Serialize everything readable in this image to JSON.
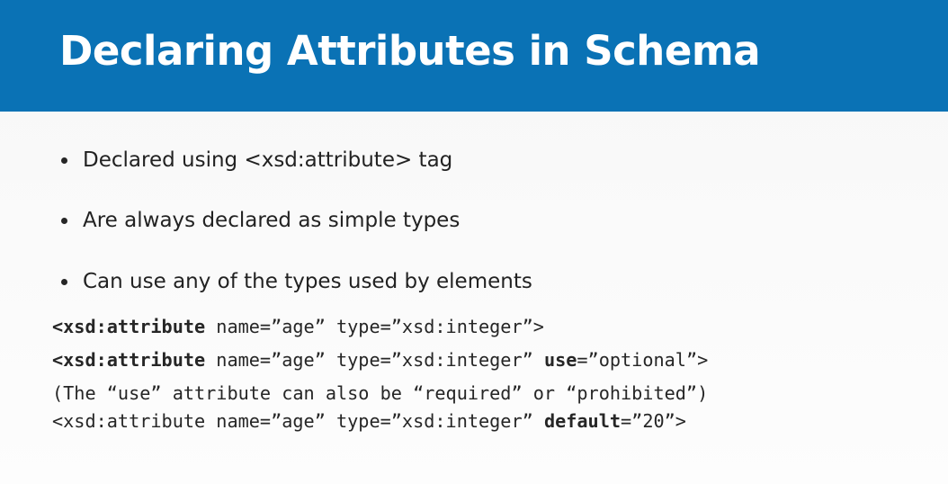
{
  "slide": {
    "title": "Declaring Attributes in Schema",
    "bullets": [
      "Declared using <xsd:attribute> tag",
      "Are always declared as simple types",
      "Can use any of the types used by elements"
    ],
    "code": {
      "line1": {
        "tag": "<xsd:attribute",
        "rest": " name=”age” type=”xsd:integer”>"
      },
      "line2": {
        "tag": "<xsd:attribute",
        "mid": " name=”age” type=”xsd:integer” ",
        "attr": "use",
        "end": "=”optional”>"
      },
      "line3": "(The “use” attribute can also be “required” or “prohibited”)",
      "line4": {
        "start": "<xsd:attribute name=”age” type=”xsd:integer” ",
        "attr": "default",
        "end": "=”20”>"
      }
    },
    "colors": {
      "header_background": "#0a72b5",
      "title_text": "#ffffff",
      "body_text": "#222222"
    }
  }
}
